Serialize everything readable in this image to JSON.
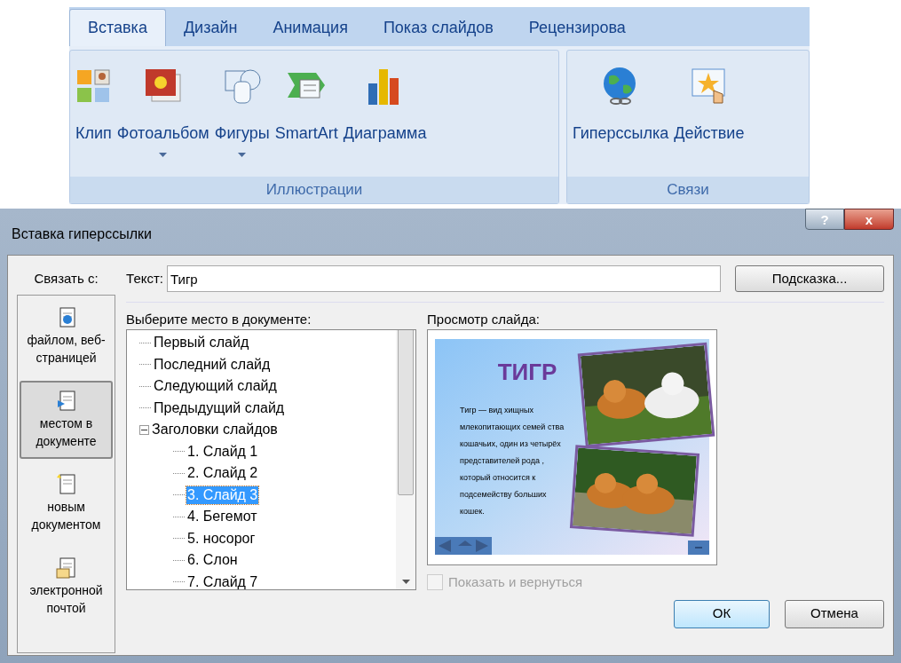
{
  "ribbon": {
    "tabs": [
      {
        "label": "Вставка",
        "selected": true
      },
      {
        "label": "Дизайн",
        "selected": false
      },
      {
        "label": "Анимация",
        "selected": false
      },
      {
        "label": "Показ слайдов",
        "selected": false
      },
      {
        "label": "Рецензирова",
        "selected": false
      }
    ],
    "groups": [
      {
        "label": "Иллюстрации",
        "buttons": [
          {
            "kind": "clip",
            "label": "Клип",
            "dropdown": false
          },
          {
            "kind": "album",
            "label": "Фотоальбом",
            "dropdown": true
          },
          {
            "kind": "shapes",
            "label": "Фигуры",
            "dropdown": true
          },
          {
            "kind": "smartart",
            "label": "SmartArt",
            "dropdown": false
          },
          {
            "kind": "chart",
            "label": "Диаграмма",
            "dropdown": false
          }
        ]
      },
      {
        "label": "Связи",
        "buttons": [
          {
            "kind": "hyperlink",
            "label": "Гиперссылка",
            "dropdown": false
          },
          {
            "kind": "action",
            "label": "Действие",
            "dropdown": false
          }
        ]
      }
    ]
  },
  "dialog": {
    "title": "Вставка гиперссылки",
    "help_button": "?",
    "close_button": "x",
    "link_to_label": "Связать с:",
    "link_targets": [
      {
        "kind": "file",
        "label": "файлом, веб-страницей",
        "selected": false
      },
      {
        "kind": "place",
        "label": "местом в документе",
        "selected": true
      },
      {
        "kind": "new",
        "label": "новым документом",
        "selected": false
      },
      {
        "kind": "email",
        "label": "электронной почтой",
        "selected": false
      }
    ],
    "text_label": "Текст:",
    "text_value": "Тигр",
    "tip_button": "Подсказка...",
    "place_label": "Выберите место в документе:",
    "places": [
      {
        "label": "Первый слайд",
        "selected": false
      },
      {
        "label": "Последний слайд",
        "selected": false
      },
      {
        "label": "Следующий слайд",
        "selected": false
      },
      {
        "label": "Предыдущий слайд",
        "selected": false
      },
      {
        "label": "Заголовки слайдов",
        "selected": false,
        "expanded": true,
        "children": [
          {
            "label": "1. Слайд 1",
            "selected": false
          },
          {
            "label": "2. Слайд 2",
            "selected": false
          },
          {
            "label": "3. Слайд 3",
            "selected": true
          },
          {
            "label": "4. Бегемот",
            "selected": false
          },
          {
            "label": "5. носорог",
            "selected": false
          },
          {
            "label": "6. Слон",
            "selected": false
          },
          {
            "label": "7. Слайд 7",
            "selected": false
          }
        ]
      }
    ],
    "preview_label": "Просмотр слайда:",
    "slide": {
      "title": "ТИГР",
      "body": "Тигр — вид хищных млекопитающих семей ства кошачьих, один из четырёх представителей рода , который относится к подсемейству больших кошек."
    },
    "show_and_return": {
      "label": "Показать и вернуться",
      "checked": false,
      "disabled": true
    },
    "ok_button": "ОК",
    "cancel_button": "Отмена"
  }
}
